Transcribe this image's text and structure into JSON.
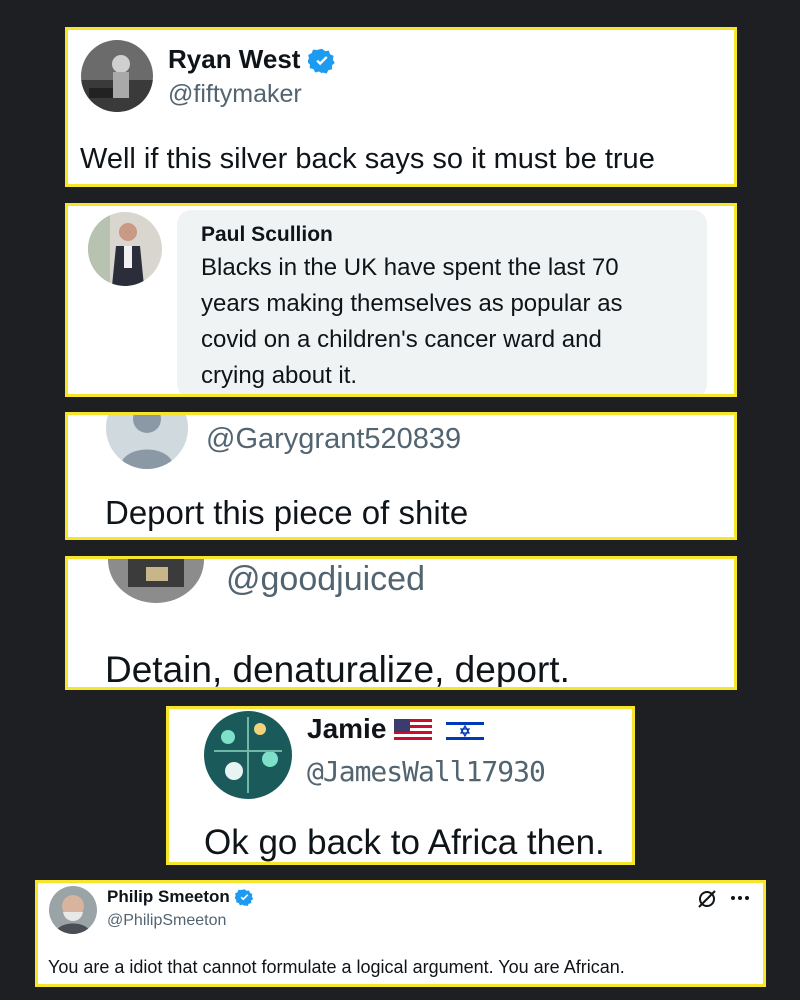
{
  "colors": {
    "background": "#1d1f22",
    "highlight_border": "#f5e52b",
    "verified_blue": "#1d9bf0",
    "text": "#0f1419",
    "muted": "#536471"
  },
  "posts": [
    {
      "name": "Ryan West",
      "verified": true,
      "handle": "@fiftymaker",
      "text": "Well if this silver back says so it must be true"
    },
    {
      "name": "Paul Scullion",
      "lines": [
        "Blacks in the UK have spent the last 70",
        "years making themselves as popular as",
        "covid on a children's cancer ward and",
        "crying about it."
      ]
    },
    {
      "handle": "@Garygrant520839",
      "text": "Deport this piece of shite"
    },
    {
      "handle": "@goodjuiced",
      "text": "Detain, denaturalize, deport."
    },
    {
      "name": "Jamie",
      "flags": [
        "us-flag-icon",
        "israel-flag-icon"
      ],
      "handle": "@JamesWall17930",
      "text": "Ok go back to Africa then."
    },
    {
      "name": "Philip Smeeton",
      "verified": true,
      "handle": "@PhilipSmeeton",
      "text": "You are a idiot that cannot formulate a logical argument. You are African.",
      "icons": [
        "grok-icon",
        "more-icon"
      ]
    }
  ]
}
